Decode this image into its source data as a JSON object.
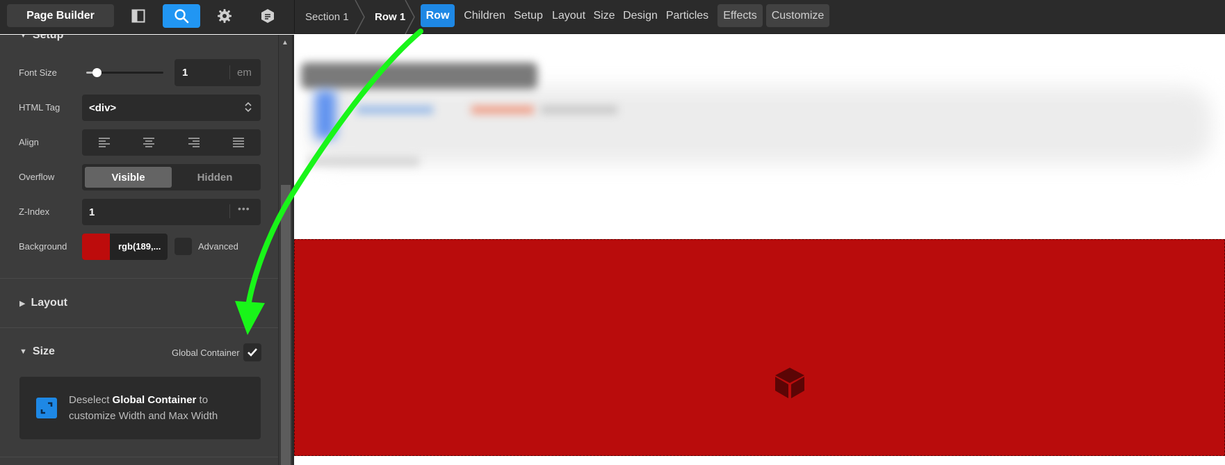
{
  "toolbar": {
    "page_builder_label": "Page Builder",
    "icons": [
      "panel-toggle-icon",
      "search-icon",
      "gear-icon",
      "notes-icon"
    ]
  },
  "breadcrumb": [
    "Section 1",
    "Row 1"
  ],
  "tabs": [
    {
      "label": "Row",
      "active": true
    },
    {
      "label": "Children"
    },
    {
      "label": "Setup"
    },
    {
      "label": "Layout"
    },
    {
      "label": "Size"
    },
    {
      "label": "Design"
    },
    {
      "label": "Particles"
    },
    {
      "label": "Effects",
      "boxed": true
    },
    {
      "label": "Customize",
      "boxed": true
    }
  ],
  "panel": {
    "setup_title": "Setup",
    "font_size": {
      "label": "Font Size",
      "value": "1",
      "unit": "em",
      "slider_fraction": 0.13
    },
    "html_tag": {
      "label": "HTML Tag",
      "value": "<div>"
    },
    "align": {
      "label": "Align",
      "options": [
        "left",
        "center",
        "right",
        "justify"
      ]
    },
    "overflow": {
      "label": "Overflow",
      "options": [
        "Visible",
        "Hidden"
      ],
      "selected": "Visible"
    },
    "z_index": {
      "label": "Z-Index",
      "value": "1"
    },
    "background": {
      "label": "Background",
      "value": "rgb(189,...",
      "swatch": "#bd0c0c",
      "advanced_label": "Advanced"
    },
    "layout_title": "Layout",
    "size_title": "Size",
    "global_container_label": "Global Container",
    "info": {
      "prefix": "Deselect ",
      "bold": "Global Container",
      "suffix": " to customize Width and Max Width"
    }
  },
  "colors": {
    "accent": "#1e88e5",
    "row_bg": "#b90c0c",
    "arrow": "#19f519"
  }
}
